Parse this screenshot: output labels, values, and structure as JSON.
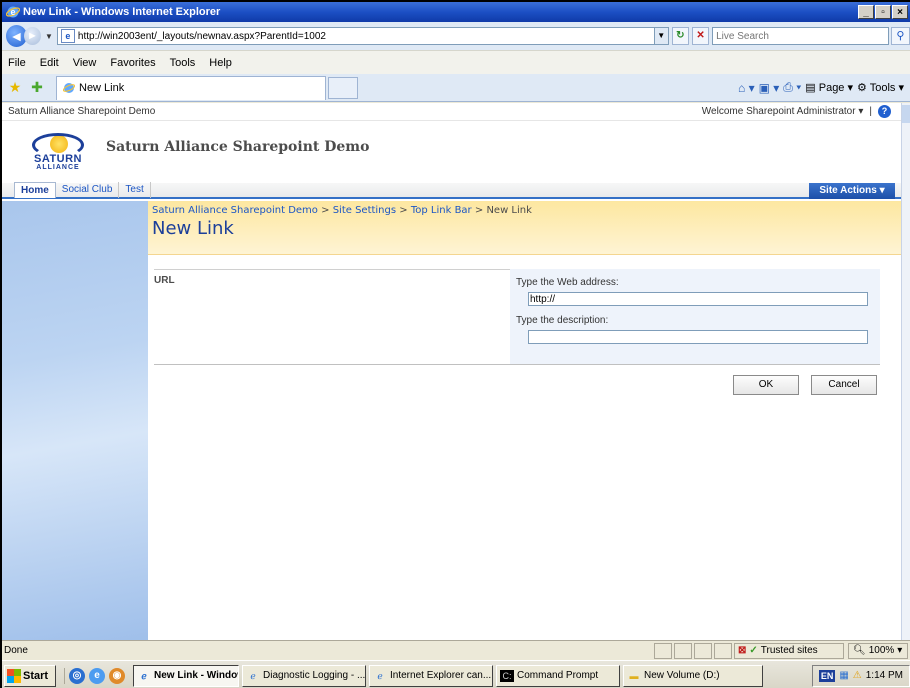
{
  "window": {
    "title": "New Link - Windows Internet Explorer",
    "controls": [
      "_",
      "▫",
      "×"
    ]
  },
  "address_bar": {
    "url": "http://win2003ent/_layouts/newnav.aspx?ParentId=1002",
    "search_placeholder": "Live Search"
  },
  "menu": [
    "File",
    "Edit",
    "View",
    "Favorites",
    "Tools",
    "Help"
  ],
  "tab": {
    "label": "New Link"
  },
  "command_bar": {
    "page": "Page",
    "tools": "Tools"
  },
  "sharepoint": {
    "top_left": "Saturn Alliance Sharepoint Demo",
    "welcome": "Welcome Sharepoint Administrator",
    "logo_word": "SATURN",
    "logo_sub": "ALLIANCE",
    "site_title": "Saturn Alliance Sharepoint Demo",
    "nav": [
      "Home",
      "Social Club",
      "Test"
    ],
    "site_actions": "Site Actions"
  },
  "breadcrumb": {
    "items": [
      "Saturn Alliance Sharepoint Demo",
      "Site Settings",
      "Top Link Bar",
      "New Link"
    ],
    "sep": ">"
  },
  "page_title": "New Link",
  "form": {
    "section_label": "URL",
    "web_address_label": "Type the Web address:",
    "web_address_value": "http://",
    "description_label": "Type the description:",
    "description_value": "",
    "ok": "OK",
    "cancel": "Cancel"
  },
  "status": {
    "text": "Done",
    "zone": "Trusted sites",
    "zoom": "100%"
  },
  "taskbar": {
    "start": "Start",
    "buttons": [
      "New Link - Window...",
      "Diagnostic Logging - ...",
      "Internet Explorer can...",
      "Command Prompt",
      "New Volume (D:)"
    ],
    "lang": "EN",
    "clock": "1:14 PM"
  },
  "colors": {
    "title_bar": "#1c4fc4",
    "breadcrumb_band": "#fde7a0",
    "page_title": "#1c3f9a",
    "site_actions": "#1c4fa8"
  }
}
